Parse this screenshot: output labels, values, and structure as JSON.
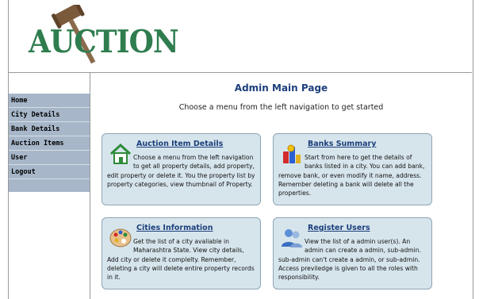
{
  "logo": {
    "text": "AUCTION"
  },
  "nav": {
    "items": [
      {
        "label": "Home",
        "name": "nav-home"
      },
      {
        "label": "City Details",
        "name": "nav-city-details"
      },
      {
        "label": "Bank Details",
        "name": "nav-bank-details"
      },
      {
        "label": "Auction Items",
        "name": "nav-auction-items"
      },
      {
        "label": "User",
        "name": "nav-user"
      },
      {
        "label": "Logout",
        "name": "nav-logout"
      }
    ]
  },
  "main": {
    "title": "Admin Main Page",
    "subtitle": "Choose a menu from the left navigation to get started"
  },
  "cards": [
    {
      "title": "Auction Item Details",
      "icon": "home-icon",
      "body": "Choose a menu from the left navigation to get all property details, add property, edit property or delete it. You the property list by property categories, view thumbnail of Property."
    },
    {
      "title": "Banks Summary",
      "icon": "bank-chart-icon",
      "body": "Start from here to get the details of banks listed in a city. You can add bank, remove bank, or even modify it name, address. Remember deleting a bank will delete all the properties."
    },
    {
      "title": "Cities Information",
      "icon": "palette-icon",
      "body": "Get the list of a city avaliable in Maharashtra State. View city details, Add city or delete it complelty. Remember, deleting a city will delete entire property records in it."
    },
    {
      "title": "Register Users",
      "icon": "users-icon",
      "body": "View the list of a admin user(s). An admin can create a admin, sub-admin. sub-admin can't create a admin, or sub-admin. Access previledge is given to all the roles with responsibility."
    }
  ]
}
